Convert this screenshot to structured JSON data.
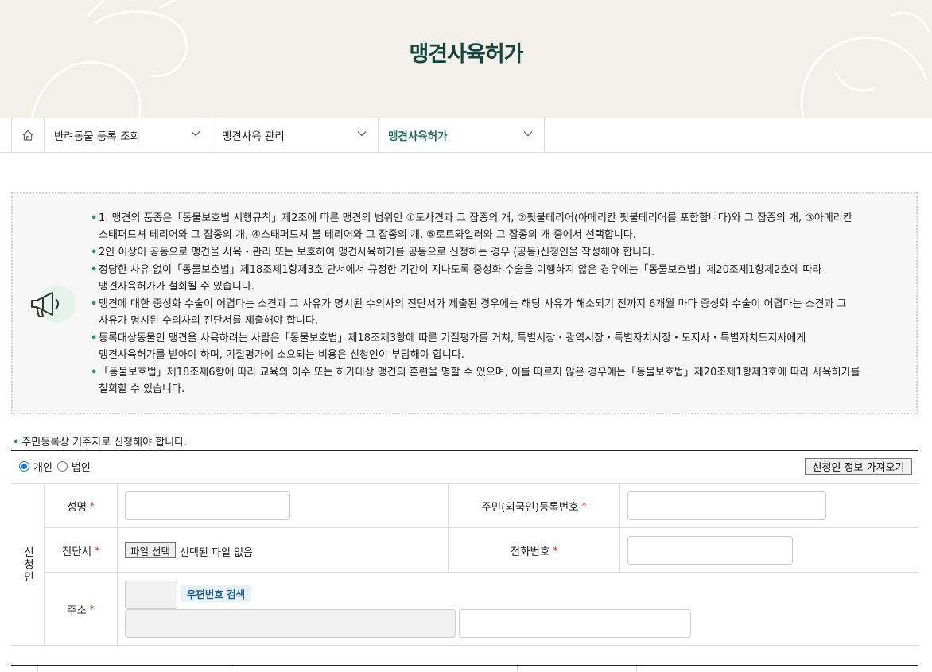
{
  "header": {
    "title": "맹견사육허가"
  },
  "breadcrumb": {
    "home_icon": "home-icon",
    "items": [
      {
        "label": "반려동물 등록 조회"
      },
      {
        "label": "맹견사육 관리"
      },
      {
        "label": "맹견사육허가"
      }
    ]
  },
  "notice": {
    "icon": "megaphone-icon",
    "items": [
      {
        "line1": "1. 맹견의 품종은「동물보호법 시행규칙」제2조에 따른 맹견의 범위인 ①도사견과 그 잡종의 개, ②핏불테리어(아메리칸 핏불테리어를 포함합니다)와 그 잡종의 개, ③아메리칸",
        "line2": "스태퍼드셔 테리어와 그 잡종의 개, ④스태퍼드셔 불 테리어와 그 잡종의 개, ⑤로트와일러와 그 잡종의 개 중에서 선택합니다."
      },
      {
        "line1": "2인 이상이 공동으로 맹견을 사육・관리 또는 보호하여 맹견사육허가를 공동으로 신청하는 경우 (공동)신청인을 작성해야 합니다.",
        "line2": ""
      },
      {
        "line1": "정당한 사유 없이「동물보호법」제18조제1항제3호 단서에서 규정한 기간이 지나도록 중성화 수술을 이행하지 않은 경우에는「동물보호법」제20조제1항제2호에 따라",
        "line2": "맹견사육허가가 철회될 수 있습니다."
      },
      {
        "line1": "맹견에 대한 중성화 수술이 어렵다는 소견과 그 사유가 명시된 수의사의 진단서가 제출된 경우에는 해당 사유가 해소되기 전까지 6개월 마다 중성화 수술이 어렵다는 소견과 그",
        "line2": "사유가 명시된 수의사의 진단서를 제출해야 합니다."
      },
      {
        "line1": "등록대상동물인 맹견을 사육하려는 사람은「동물보호법」제18조제3항에 따른 기질평가를 거쳐, 특별시장・광역시장・특별자치시장・도지사・특별자치도지사에게",
        "line2": "맹견사육허가를 받아야 하며, 기질평가에 소요되는 비용은 신청인이 부담해야 합니다."
      },
      {
        "line1": "「동물보호법」제18조제6항에 따라 교육의 이수 또는 허가대상 맹견의 훈련을 명할 수 있으며, 이를 따르지 않은 경우에는「동물보호법」제20조제1항제3호에 따라 사육허가를",
        "line2": "철회할 수 있습니다."
      }
    ]
  },
  "instruction": "주민등록상 거주지로 신청해야 합니다.",
  "applicant_type": {
    "options": [
      {
        "label": "개인",
        "selected": true
      },
      {
        "label": "법인",
        "selected": false
      }
    ]
  },
  "fetch_button": "신청인 정보 가져오기",
  "form": {
    "section_label": "신청인",
    "required_mark": "*",
    "name_label": "성명",
    "id_label": "주민(외국인)등록번호",
    "diagnosis_label": "진단서",
    "phone_label": "전화번호",
    "address_label": "주소",
    "file_button": "파일 선택",
    "file_status": "선택된 파일 없음",
    "zip_button": "우편번호 검색"
  }
}
